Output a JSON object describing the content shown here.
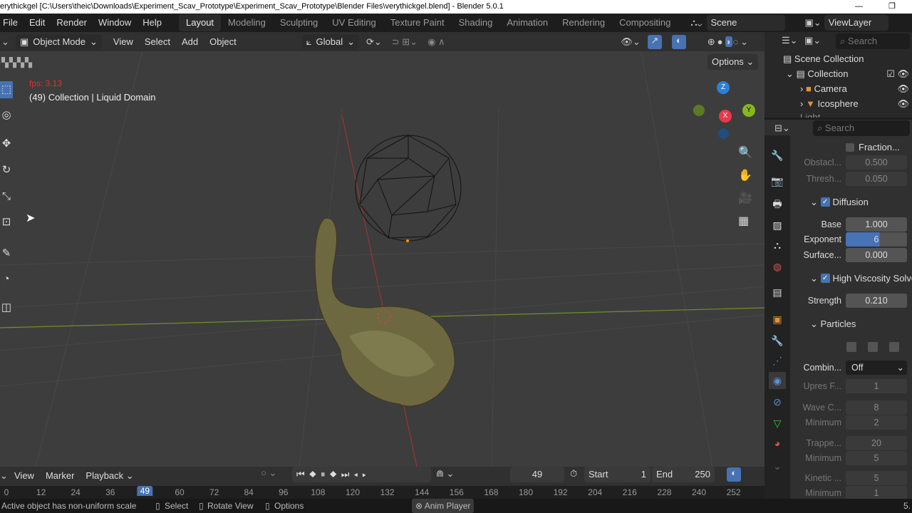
{
  "window": {
    "title": "erythickgel [C:\\Users\\theic\\Downloads\\Experiment_Scav_Prototype\\Experiment_Scav_Prototype\\Blender Files\\verythickgel.blend] - Blender 5.0.1",
    "minimize": "—",
    "restore": "❐"
  },
  "menu": [
    "File",
    "Edit",
    "Render",
    "Window",
    "Help"
  ],
  "workspaces": [
    "Layout",
    "Modeling",
    "Sculpting",
    "UV Editing",
    "Texture Paint",
    "Shading",
    "Animation",
    "Rendering",
    "Compositing"
  ],
  "scene": "Scene",
  "view_layer": "ViewLayer",
  "viewport_header": {
    "mode": "Object Mode",
    "menus": [
      "View",
      "Select",
      "Add",
      "Object"
    ],
    "orientation": "Global",
    "options": "Options"
  },
  "viewport": {
    "fps": "fps: 3.13",
    "info": "(49) Collection | Liquid Domain",
    "gizmo": {
      "z": "Z",
      "y": "Y",
      "x": "X"
    }
  },
  "outliner": {
    "search_placeholder": "Search",
    "items": [
      "Scene Collection",
      "Collection",
      "Camera",
      "Icosphere",
      "Light"
    ]
  },
  "properties": {
    "search_placeholder": "Search",
    "fraction": "Fraction...",
    "rows1": [
      {
        "label": "Obstacl...",
        "value": "0.500"
      },
      {
        "label": "Thresh...",
        "value": "0.050"
      }
    ],
    "diffusion": "Diffusion",
    "rows2": [
      {
        "label": "Base",
        "value": "1.000"
      },
      {
        "label": "Exponent",
        "value": "6"
      },
      {
        "label": "Surface...",
        "value": "0.000"
      }
    ],
    "hvs": "High Viscosity Solver",
    "strength": {
      "label": "Strength",
      "value": "0.210"
    },
    "particles": "Particles",
    "combine": {
      "label": "Combin...",
      "value": "Off"
    },
    "rows3": [
      {
        "label": "Upres F...",
        "value": "1"
      },
      {
        "label": "Wave C...",
        "value": "8"
      },
      {
        "label": "Minimum",
        "value": "2"
      },
      {
        "label": "Trappe...",
        "value": "20"
      },
      {
        "label": "Minimum",
        "value": "5"
      },
      {
        "label": "Kinetic ...",
        "value": "5"
      },
      {
        "label": "Minimum",
        "value": "1"
      }
    ]
  },
  "timeline": {
    "menus": [
      "View",
      "Marker",
      "Playback"
    ],
    "current_frame": "49",
    "start_label": "Start",
    "start": "1",
    "end_label": "End",
    "end": "250",
    "ticks": [
      "0",
      "12",
      "24",
      "36",
      "49",
      "60",
      "72",
      "84",
      "96",
      "108",
      "120",
      "132",
      "144",
      "156",
      "168",
      "180",
      "192",
      "204",
      "216",
      "228",
      "240",
      "252"
    ]
  },
  "status": {
    "message": "Active object has non-uniform scale",
    "select": "Select",
    "rotate": "Rotate View",
    "options": "Options",
    "anim_player": "Anim Player",
    "version": "5."
  }
}
